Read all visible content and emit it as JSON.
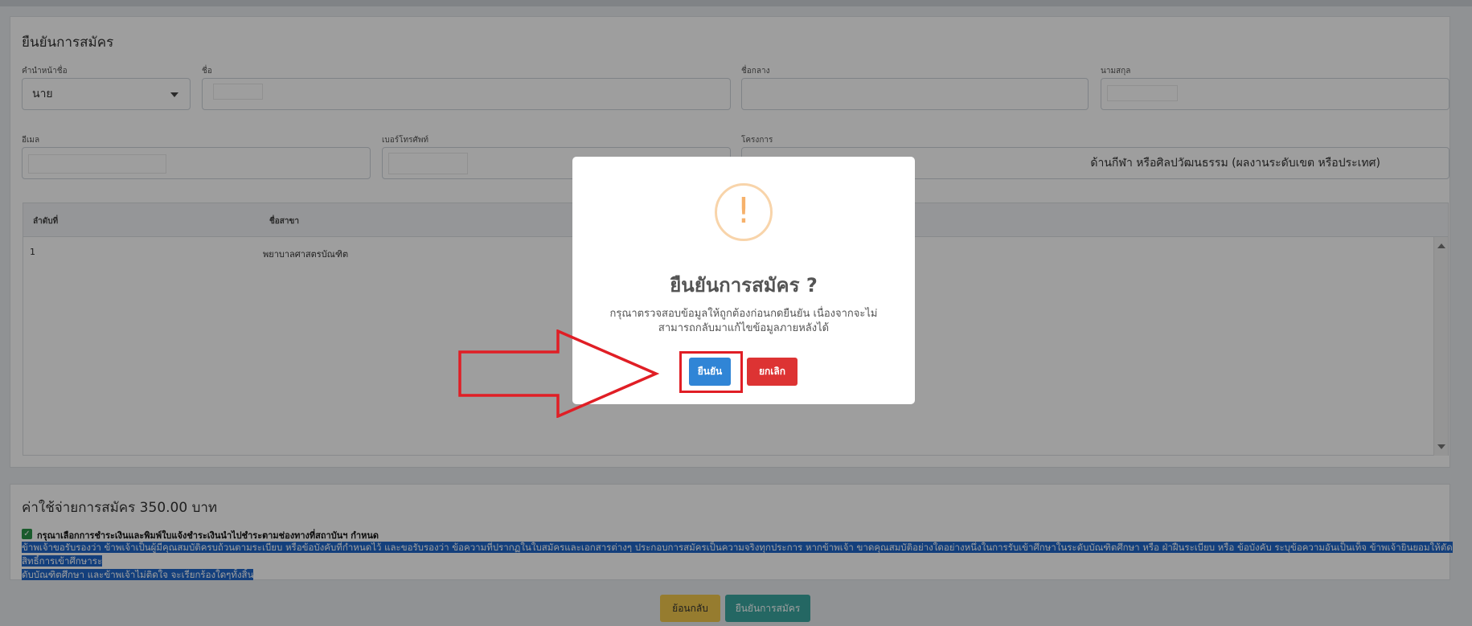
{
  "form": {
    "section_title": "ยืนยันการสมัคร",
    "title_prefix": {
      "label": "คำนำหน้าชื่อ",
      "value": "นาย"
    },
    "first_name": {
      "label": "ชื่อ",
      "value": ""
    },
    "middle_name": {
      "label": "ชื่อกลาง",
      "value": ""
    },
    "last_name": {
      "label": "นามสกุล",
      "value": ""
    },
    "email": {
      "label": "อีเมล",
      "value": ""
    },
    "phone": {
      "label": "เบอร์โทรศัพท์",
      "value": ""
    },
    "project": {
      "label": "โครงการ",
      "value_visible": "ด้านกีฬา หรือศิลปวัฒนธรรม (ผลงานระดับเขต หรือประเทศ)"
    }
  },
  "table": {
    "headers": [
      "ลำดับที่",
      "ชื่อสาขา"
    ],
    "rows": [
      {
        "no": "1",
        "major": "พยาบาลศาสตรบัณฑิต"
      }
    ]
  },
  "fee": {
    "title": "ค่าใช้จ่ายการสมัคร 350.00 บาท",
    "checkbox_label": "กรุณาเลือกการชำระเงินและพิมพ์ใบแจ้งชำระเงินนำไปชำระตามช่องทางที่สถาบันฯ กำหนด",
    "checkbox_checked": true,
    "declaration_line1": "ข้าพเจ้าขอรับรองว่า ข้าพเจ้าเป็นผู้มีคุณสมบัติครบถ้วนตามระเบียบ หรือข้อบังคับที่กำหนดไว้ และขอรับรองว่า ข้อความที่ปรากฏในใบสมัครและเอกสารต่างๆ ประกอบการสมัครเป็นความจริงทุกประการ หากข้าพเจ้า ขาดคุณสมบัติอย่างใดอย่างหนึ่งในการรับเข้าศึกษาในระดับบัณฑิตศึกษา หรือ ฝ่าฝืนระเบียบ หรือ ข้อบังคับ ระบุข้อความอันเป็นเท็จ ข้าพเจ้ายินยอมให้ตัดสิทธิ์การเข้าศึกษาระ",
    "declaration_line2": "ดับบัณฑิตศึกษา และข้าพเจ้าไม่ติดใจ จะเรียกร้องใดๆทั้งสิ้น"
  },
  "footer": {
    "back_label": "ย้อนกลับ",
    "submit_label": "ยืนยันการสมัคร"
  },
  "modal": {
    "icon": "!",
    "title": "ยืนยันการสมัคร ?",
    "text_line1": "กรุณาตรวจสอบข้อมูลให้ถูกต้องก่อนกดยืนยัน เนื่องจากจะไม่",
    "text_line2": "สามารถกลับมาแก้ไขข้อมูลภายหลังได้",
    "confirm_label": "ยืนยัน",
    "cancel_label": "ยกเลิก"
  },
  "colors": {
    "confirm": "#3085d6",
    "cancel": "#dd3333",
    "annotation": "#e01e25",
    "warning": "#f8bb86",
    "selection": "#1f66c8"
  }
}
